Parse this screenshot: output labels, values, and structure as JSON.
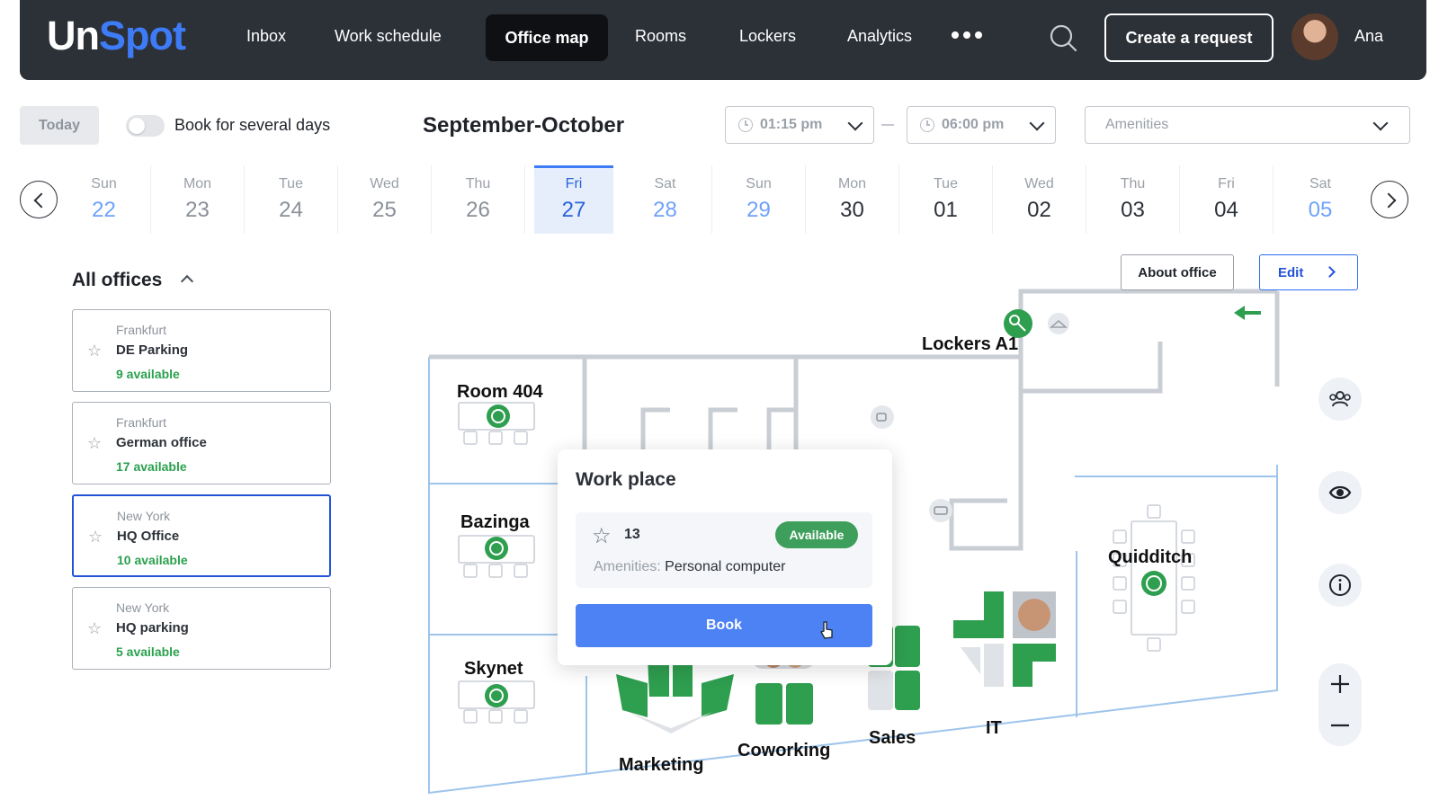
{
  "app": {
    "logo_part1": "Un",
    "logo_part2": "Spot"
  },
  "nav": {
    "items": [
      {
        "label": "Inbox"
      },
      {
        "label": "Work schedule"
      },
      {
        "label": "Office map",
        "active": true
      },
      {
        "label": "Rooms"
      },
      {
        "label": "Lockers"
      },
      {
        "label": "Analytics"
      }
    ],
    "more_icon": "ellipsis-icon",
    "search_icon": "search-icon",
    "create_label": "Create a request",
    "user_name": "Ana"
  },
  "filters": {
    "today_label": "Today",
    "several_days_label": "Book for several days",
    "several_days_on": false,
    "month_title": "September-October",
    "time_from": "01:15 pm",
    "time_to": "06:00 pm",
    "amenities_placeholder": "Amenities"
  },
  "days": [
    {
      "dow": "Sun",
      "num": "22"
    },
    {
      "dow": "Mon",
      "num": "23"
    },
    {
      "dow": "Tue",
      "num": "24"
    },
    {
      "dow": "Wed",
      "num": "25"
    },
    {
      "dow": "Thu",
      "num": "26"
    },
    {
      "dow": "Fri",
      "num": "27",
      "selected": true
    },
    {
      "dow": "Sat",
      "num": "28"
    },
    {
      "dow": "Sun",
      "num": "29"
    },
    {
      "dow": "Mon",
      "num": "30"
    },
    {
      "dow": "Tue",
      "num": "01"
    },
    {
      "dow": "Wed",
      "num": "02"
    },
    {
      "dow": "Thu",
      "num": "03"
    },
    {
      "dow": "Fri",
      "num": "04"
    },
    {
      "dow": "Sat",
      "num": "05"
    }
  ],
  "offices": {
    "title": "All offices",
    "list": [
      {
        "city": "Frankfurt",
        "name": "DE Parking",
        "available": "9 available"
      },
      {
        "city": "Frankfurt",
        "name": "German office",
        "available": "17 available"
      },
      {
        "city": "New York",
        "name": "HQ Office",
        "available": "10 available",
        "selected": true
      },
      {
        "city": "New York",
        "name": "HQ parking",
        "available": "5 available"
      }
    ]
  },
  "map": {
    "about_label": "About office",
    "edit_label": "Edit",
    "rooms": [
      "Room 404",
      "Bazinga",
      "Skynet",
      "Quidditch",
      "Lockers A1"
    ],
    "zones": [
      "Marketing",
      "Coworking",
      "Sales",
      "IT"
    ],
    "tools": [
      "people-icon",
      "eye-icon",
      "info-icon"
    ],
    "zoom_in": "plus-icon",
    "zoom_out": "minus-icon",
    "accent": "#2e9e4f",
    "wall": "#c9ced5",
    "boundary": "#9ec4ec"
  },
  "popup": {
    "title": "Work place",
    "seat": "13",
    "status": "Available",
    "amenities_key": "Amenities:",
    "amenities_value": "Personal computer",
    "book_label": "Book"
  }
}
